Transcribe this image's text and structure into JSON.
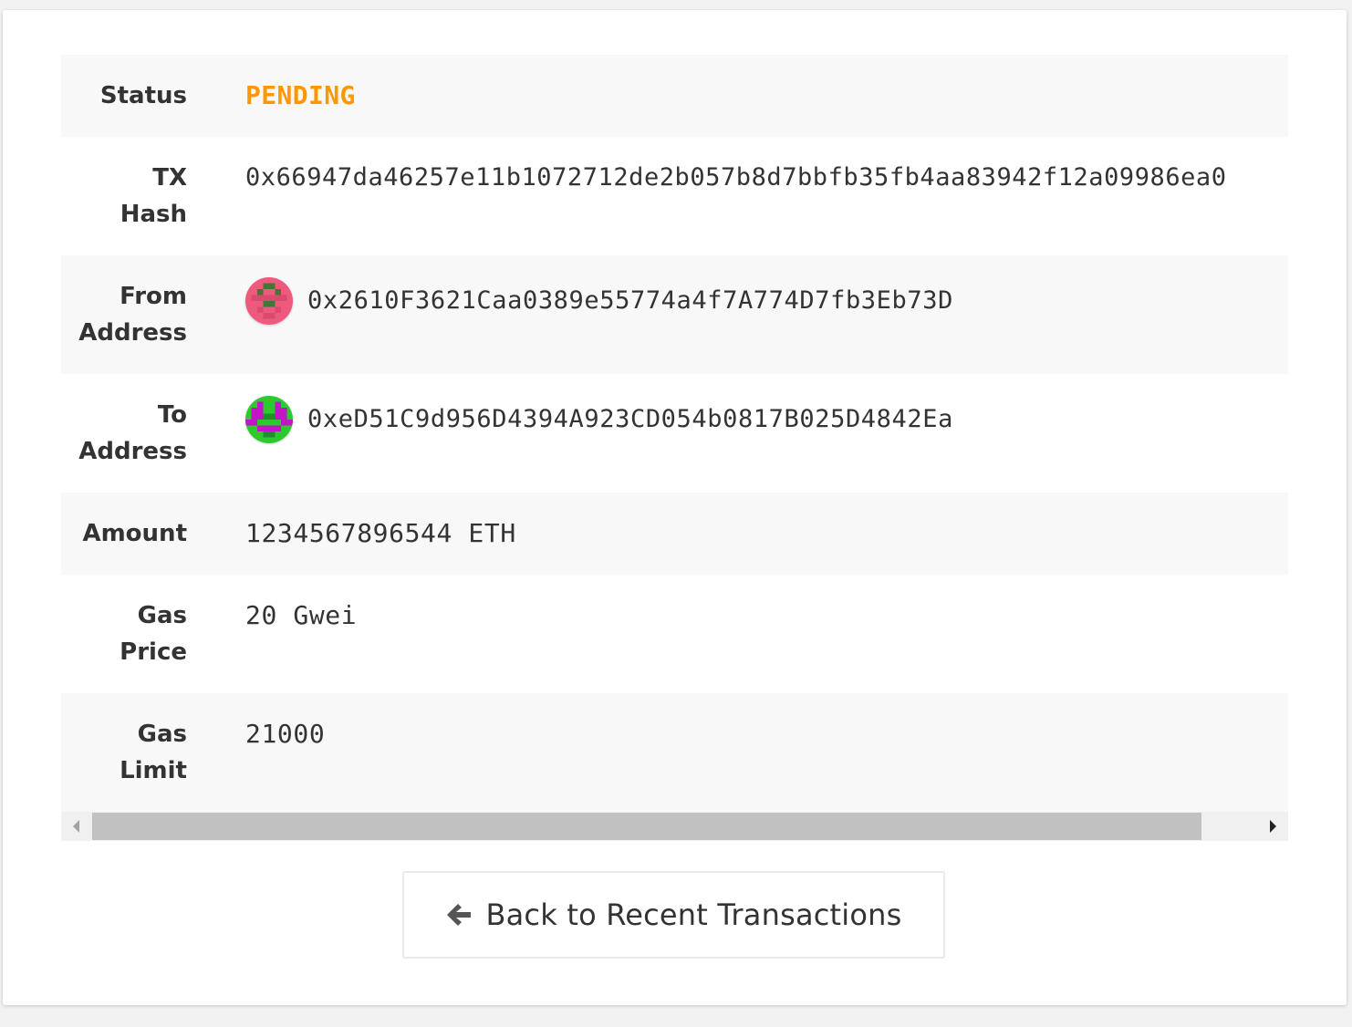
{
  "details": {
    "status": {
      "label": "Status",
      "value": "PENDING",
      "color": "#ff9800"
    },
    "tx_hash": {
      "label_line1": "TX",
      "label_line2": "Hash",
      "value": "0x66947da46257e11b1072712de2b057b8d7bbfb35fb4aa83942f12a09986ea0"
    },
    "from_address": {
      "label_line1": "From",
      "label_line2": "Address",
      "value": "0x2610F3621Caa0389e55774a4f7A774D7fb3Eb73D",
      "identicon_colors": [
        "#ee5a7e",
        "#3f7a35"
      ]
    },
    "to_address": {
      "label_line1": "To",
      "label_line2": "Address",
      "value": "0xeD51C9d956D4394A923CD054b0817B025D4842Ea",
      "identicon_colors": [
        "#2cc92f",
        "#c314c7"
      ]
    },
    "amount": {
      "label": "Amount",
      "value": "1234567896544 ETH"
    },
    "gas_price": {
      "label_line1": "Gas",
      "label_line2": "Price",
      "value": "20 Gwei"
    },
    "gas_limit": {
      "label_line1": "Gas",
      "label_line2": "Limit",
      "value": "21000"
    }
  },
  "back_button": {
    "label": "Back to Recent Transactions",
    "icon": "arrow-left-icon"
  }
}
